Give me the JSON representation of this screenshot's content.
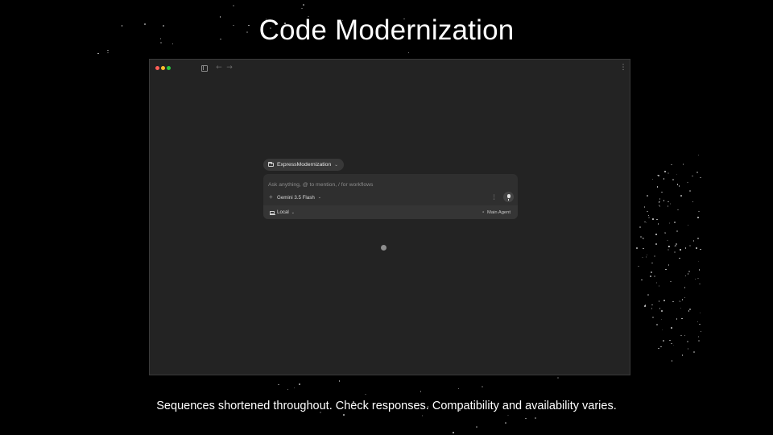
{
  "slide": {
    "title": "Code Modernization",
    "disclaimer": "Sequences shortened throughout. Check responses. Compatibility and availability varies."
  },
  "window": {
    "traffic_lights": [
      "#ff5f57",
      "#febc2e",
      "#28c840"
    ],
    "icons": {
      "sidebar_toggle": "sidebar-toggle-icon",
      "back": "arrow-left-icon",
      "forward": "arrow-right-icon",
      "more": "more-vertical-icon"
    }
  },
  "composer": {
    "workspace": {
      "icon": "folder-icon",
      "label": "ExpressModernization"
    },
    "input": {
      "placeholder": "Ask anything, @ to mention, / for workflows",
      "value": ""
    },
    "add_icon": "plus-icon",
    "model": {
      "label": "Gemini 3.5 Flash"
    },
    "more_icon": "more-vertical-icon",
    "mic_icon": "microphone-icon",
    "environment": {
      "icon": "laptop-icon",
      "label": "Local"
    },
    "agent": {
      "icon": "agent-icon",
      "label": "Main Agent"
    }
  },
  "colors": {
    "background": "#000000",
    "window": "#232323",
    "panel": "#2f2f2f",
    "chip": "#383838"
  }
}
